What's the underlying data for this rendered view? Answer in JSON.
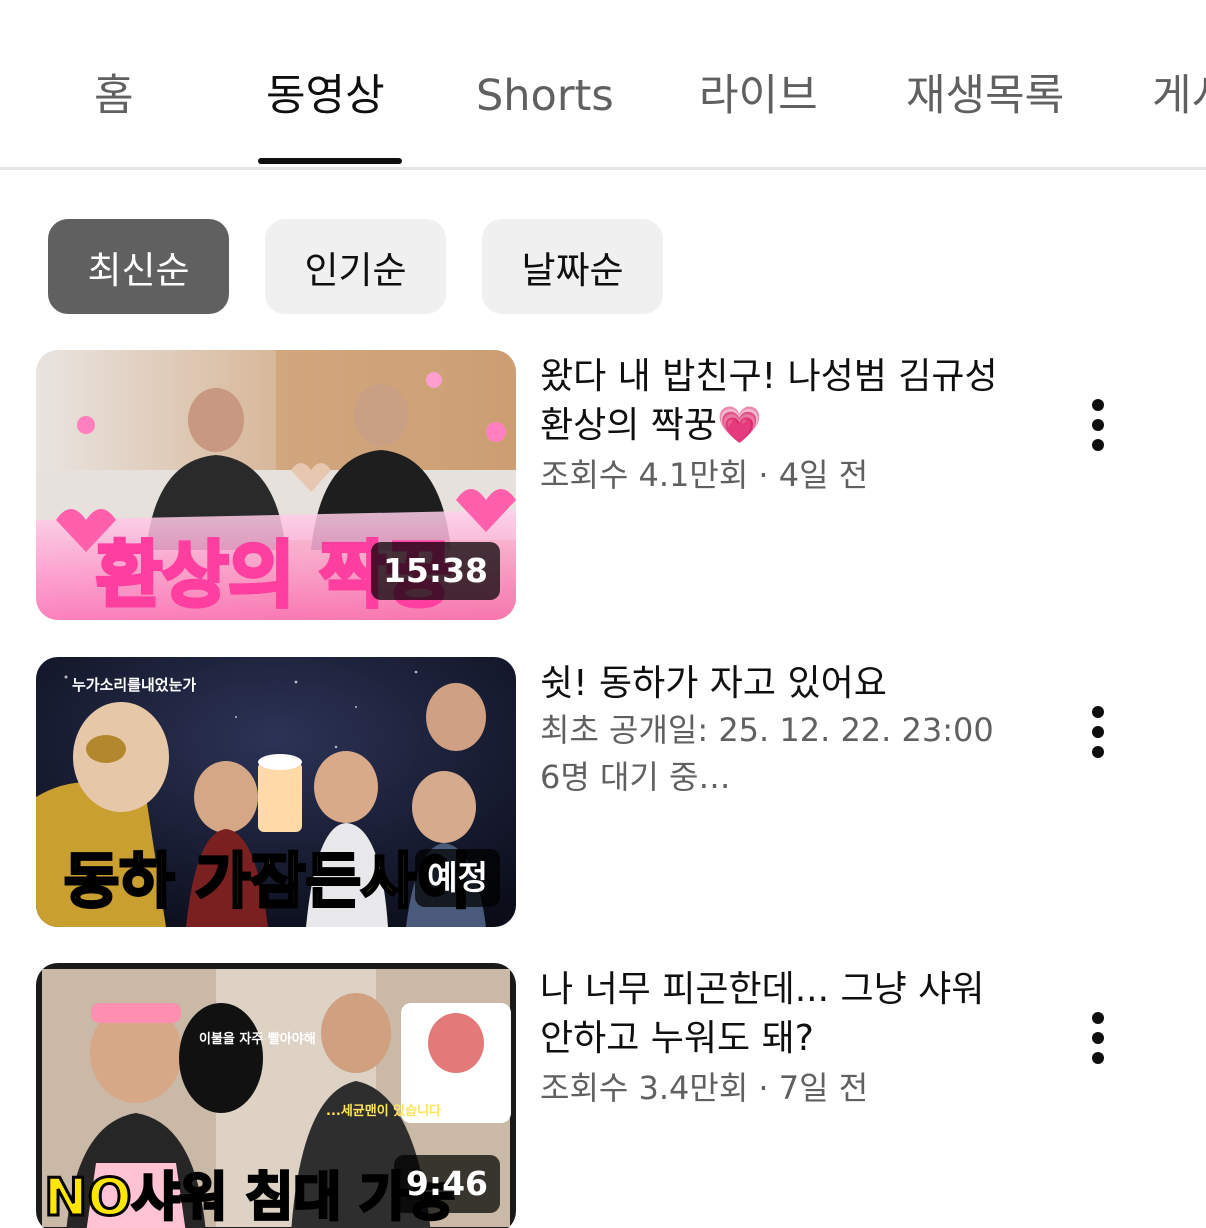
{
  "tabs": [
    {
      "label": "홈",
      "active": false
    },
    {
      "label": "동영상",
      "active": true
    },
    {
      "label": "Shorts",
      "active": false
    },
    {
      "label": "라이브",
      "active": false
    },
    {
      "label": "재생목록",
      "active": false
    },
    {
      "label": "게시",
      "active": false
    }
  ],
  "sort_chips": [
    {
      "label": "최신순",
      "selected": true
    },
    {
      "label": "인기순",
      "selected": false
    },
    {
      "label": "날짜순",
      "selected": false
    }
  ],
  "videos": [
    {
      "title": "왔다 내 밥친구! 나성범 김규성 환상의 짝꿍💗",
      "meta_line1": "조회수 4.1만회 · 4일 전",
      "meta_line2": "",
      "badge": "15:38",
      "thumb_text": "환상의 짝꿍"
    },
    {
      "title": "쉿! 동하가 자고 있어요",
      "meta_line1": "최초 공개일: 25. 12. 22. 23:00",
      "meta_line2": "6명 대기 중",
      "badge": "예정",
      "thumb_text": "동하 가잠든사이",
      "thumb_caption": "누가소리를내었는가"
    },
    {
      "title": "나 너무 피곤한데... 그냥 샤워 안하고 누워도 돼?",
      "meta_line1": "조회수 3.4만회 · 7일 전",
      "meta_line2": "",
      "badge": "9:46",
      "thumb_text": "NO샤워 침대 가능",
      "thumb_bubble": "이불을 자주 빨아야해",
      "thumb_caption": "...세균맨이 있습니다"
    }
  ],
  "icons": {
    "more": "more-vert-icon"
  },
  "colors": {
    "text_primary": "#0f0f0f",
    "text_secondary": "#606060",
    "chip_selected_bg": "#606060",
    "chip_bg": "#f0f0f0"
  }
}
